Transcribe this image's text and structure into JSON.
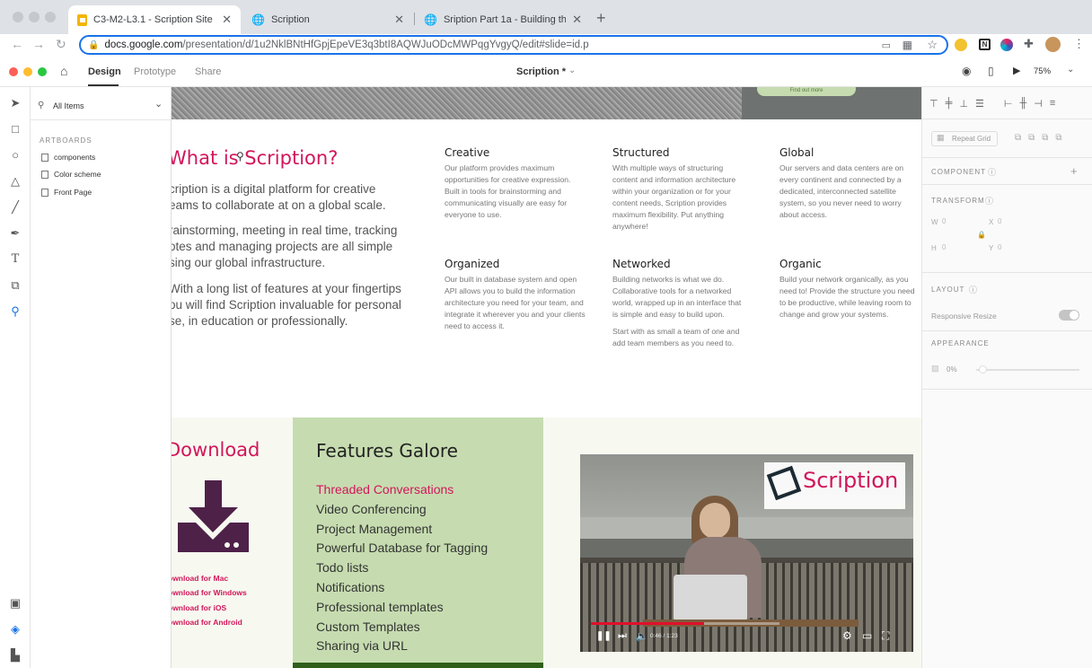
{
  "browser": {
    "tabs": [
      {
        "title": "C3-M2-L3.1 - Scription Site - ",
        "icon": "google-slides-icon"
      },
      {
        "title": "Scription",
        "icon": "globe-icon"
      },
      {
        "title": "Sription Part 1a - Building the ",
        "icon": "globe-icon"
      }
    ],
    "url_host": "docs.google.com",
    "url_path": "/presentation/d/1u2NklBNtHfGpjEpeVE3q3btI8AQWJuODcMWPqgYvgyQ/edit#slide=id.p"
  },
  "xd": {
    "tabs": [
      "Design",
      "Prototype",
      "Share"
    ],
    "doc_title": "Scription *",
    "zoom": "75%",
    "search_label": "All Items",
    "artboards_label": "ARTBOARDS",
    "artboards": [
      "components",
      "Color scheme",
      "Front Page"
    ]
  },
  "right_panel": {
    "repeat_grid": "Repeat Grid",
    "component": "COMPONENT",
    "transform": "TRANSFORM",
    "w_label": "W",
    "w_value": "0",
    "x_label": "X",
    "x_value": "0",
    "h_label": "H",
    "h_value": "0",
    "y_label": "Y",
    "y_value": "0",
    "layout": "LAYOUT",
    "responsive_resize": "Responsive Resize",
    "appearance": "APPEARANCE",
    "opacity": "0%"
  },
  "page": {
    "hero_button": "Find out more",
    "heading": "What is Scription?",
    "paragraphs": [
      "cription is a digital platform for creative\neams to collaborate at on a global scale.",
      "rainstorming, meeting in real time, tracking\notes and managing projects are all simple\nsing our global infrastructure.",
      "With a long list of features at your fingertips\nou will find Scription invaluable for personal\nse, in education or professionally."
    ],
    "features": [
      {
        "title": "Creative",
        "text": "Our platform provides maximum opportunities for creative expression. Built in tools for brainstorming and communicating visually are easy for everyone to use."
      },
      {
        "title": "Structured",
        "text": "With multiple ways of structuring content and information architecture within your organization or for your content needs, Scription provides maximum flexibility. Put anything anywhere!"
      },
      {
        "title": "Global",
        "text": "Our servers and data centers are on every continent and connected by a dedicated, interconnected satellite system, so you never need to worry about access."
      },
      {
        "title": "Organized",
        "text": "Our built in database system and open API allows you to build the information architecture you need for your team, and integrate it wherever you and your clients need to access it."
      },
      {
        "title": "Networked",
        "text": "Building networks is what we do. Collaborative tools for a networked world, wrapped up in an interface that is simple and easy to build upon.",
        "text2": "Start with as small a team of one and add team members as you need to."
      },
      {
        "title": "Organic",
        "text": "Build your network organically, as you need to! Provide the structure you need to be productive, while leaving room to change and grow your systems."
      }
    ],
    "download_heading": "Download",
    "download_links": [
      "ownload for Mac",
      "ownload for Windows",
      "ownload for iOS",
      "ownload for Android"
    ],
    "features_heading": "Features Galore",
    "features_list": [
      "Threaded Conversations",
      "Video Conferencing",
      "Project Management",
      "Powerful Database for Tagging",
      "Todo lists",
      "Notifications",
      "Professional templates",
      "Custom Templates",
      "Sharing via URL"
    ],
    "video_logo": "Scription",
    "video_time": "0:46 / 1:23",
    "video_progress": 0.6
  },
  "colors": {
    "pink": "#d2165a",
    "green_bg": "#c6dcb0",
    "purple": "#4e2149"
  }
}
